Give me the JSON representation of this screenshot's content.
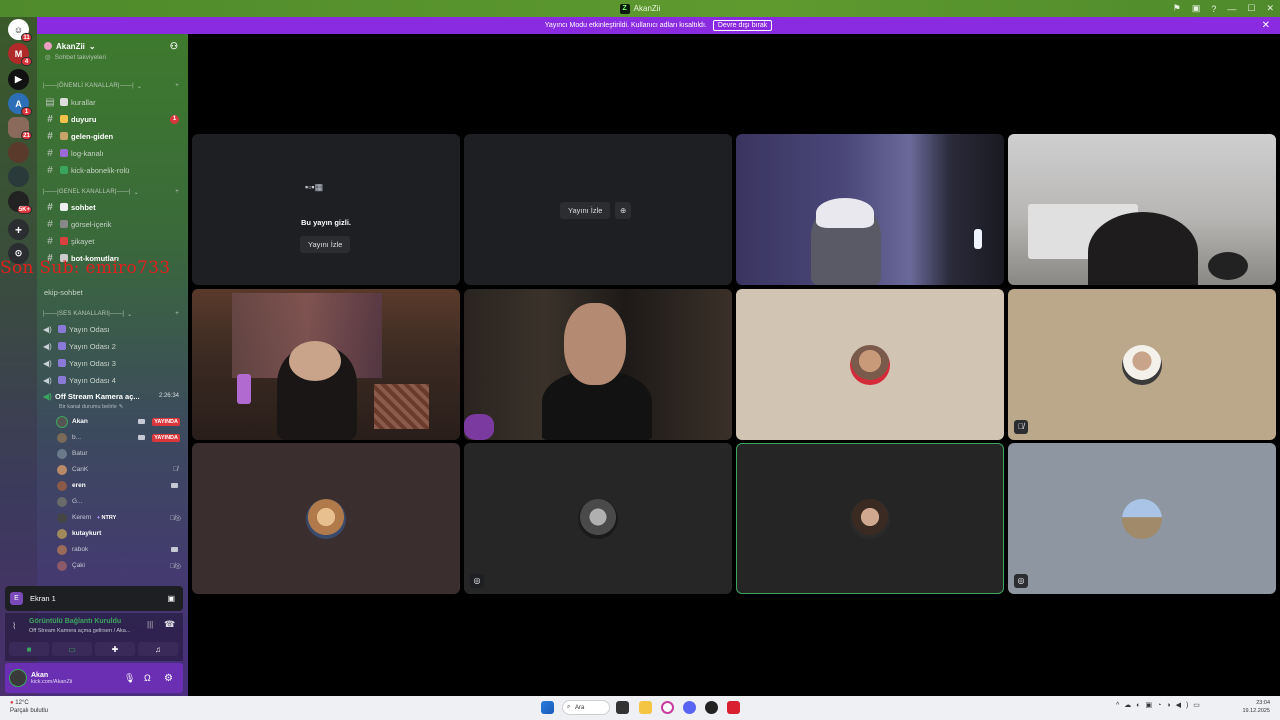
{
  "window": {
    "title": "AkanZii"
  },
  "banner": {
    "text": "Yayıncı Modu etkinleştirildi. Kullanıcı adları kısaltıldı.",
    "button": "Devre dışı bırak",
    "close": "✕"
  },
  "rail": {
    "badges": [
      "11",
      "4",
      "1",
      "21",
      "5K+"
    ]
  },
  "server": {
    "name": "AkanZii",
    "partial_top_channel": "Sohbet takviyeleri"
  },
  "categories": {
    "important": "|——|ÖNEMLİ KANALLAR|——|",
    "general": "|——|GENEL KANALLAR|——|",
    "voice": "|——|SES KANALLARI|——|"
  },
  "channels": {
    "kurallar": "kurallar",
    "duyuru": "duyuru",
    "duyuru_badge": "1",
    "gelen_giden": "gelen-giden",
    "log_kanali": "log-kanalı",
    "kick_abonelik": "kick-abonelik-rolü",
    "sohbet": "sohbet",
    "gorsel_icerik": "görsel-içerik",
    "sikayet": "şikayet",
    "bot_komutlari": "bot-komutları",
    "ekip_sohbet": "ekip-sohbet"
  },
  "voice_channels": [
    "Yayın Odası",
    "Yayın Odası 2",
    "Yayın Odası 3",
    "Yayın Odası 4"
  ],
  "active_voice": {
    "name": "Off Stream Kamera aç...",
    "timer": "2:26:34",
    "status": "Bir kanal durumu belirle"
  },
  "members": [
    {
      "name": "Akan",
      "live": "YAYINDA"
    },
    {
      "name": "b...",
      "live": "YAYINDA"
    },
    {
      "name": "Batur"
    },
    {
      "name": "CanK"
    },
    {
      "name": "eren"
    },
    {
      "name": "G..."
    },
    {
      "name": "Kerem",
      "tag": "NTRY"
    },
    {
      "name": "kutaykurt"
    },
    {
      "name": "rabok"
    },
    {
      "name": "Çaki"
    }
  ],
  "watermark": "Son Sub: emiro733",
  "screen_panel": {
    "icon_letter": "E",
    "label": "Ekran 1"
  },
  "voice_panel": {
    "status": "Görüntülü Bağlantı Kuruldu",
    "channel": "Off Stream Kamera açma gelirsen / Aka..."
  },
  "user_panel": {
    "name": "Akan",
    "status": "kick.com/AkanZii"
  },
  "tiles": {
    "hidden_text": "Bu yayın gizli.",
    "watch_label_1": "Yayını İzle",
    "watch_label_2": "Yayını İzle"
  },
  "taskbar": {
    "weather_temp": "12°C",
    "weather_desc": "Parçalı bulutlu",
    "search": "Ara",
    "time": "23:04",
    "date": "19.12.2025"
  },
  "colors": {
    "accent_purple": "#8a2be2",
    "live_red": "#da373c",
    "speaking_green": "#3ba55d",
    "title_green": "#5e9a2e"
  }
}
